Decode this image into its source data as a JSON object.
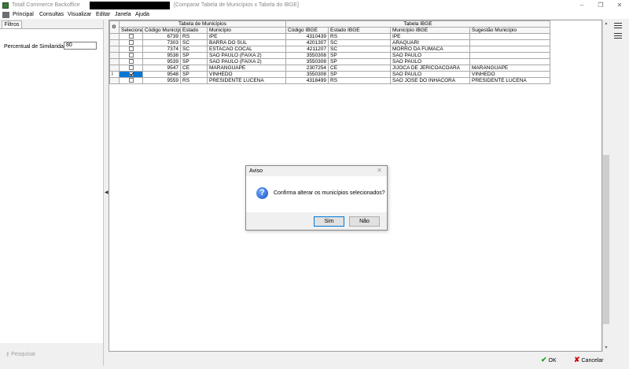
{
  "window": {
    "app_title": "Totall Commerce Backoffice",
    "doc_title": "[Comparar Tabela de Municípios x Tabela do IBGE]",
    "min_glyph": "–",
    "restore_glyph": "❐",
    "close_glyph": "✕"
  },
  "menu": [
    "Principal",
    "Consultas",
    "Visualizar",
    "Editar",
    "Janela",
    "Ajuda"
  ],
  "filters": {
    "tab_label": "Filtros",
    "similarity_label": "Percentual de Similaridade:",
    "similarity_value": "80",
    "search_button": "Pesquisar"
  },
  "grid": {
    "group_municipios": "Tabela de Municípios",
    "group_ibge": "Tabela IBGE",
    "columns": [
      "Selecionar",
      "Código Município",
      "Estado",
      "Município",
      "Código IBGE",
      "Estado IBGE",
      "Município IBGE",
      "Sugestão Município"
    ],
    "rows": [
      {
        "checked": false,
        "codigo": "6739",
        "estado": "RS",
        "municipio": "IPE",
        "codigo_ibge": "4310439",
        "estado_ibge": "RS",
        "municipio_ibge": "IPE",
        "sugestao": ""
      },
      {
        "checked": false,
        "codigo": "7303",
        "estado": "SC",
        "municipio": "BARRA DO SUL",
        "codigo_ibge": "4201307",
        "estado_ibge": "SC",
        "municipio_ibge": "ARAQUARI",
        "sugestao": ""
      },
      {
        "checked": false,
        "codigo": "7374",
        "estado": "SC",
        "municipio": "ESTACAO COCAL",
        "codigo_ibge": "4211207",
        "estado_ibge": "SC",
        "municipio_ibge": "MORRO DA FUMACA",
        "sugestao": ""
      },
      {
        "checked": false,
        "codigo": "9538",
        "estado": "SP",
        "municipio": "SAO PAULO (FAIXA 2)",
        "codigo_ibge": "3550308",
        "estado_ibge": "SP",
        "municipio_ibge": "SAO PAULO",
        "sugestao": ""
      },
      {
        "checked": false,
        "codigo": "9539",
        "estado": "SP",
        "municipio": "SAO PAULO (FAIXA 2)",
        "codigo_ibge": "3550308",
        "estado_ibge": "SP",
        "municipio_ibge": "SAO PAULO",
        "sugestao": ""
      },
      {
        "checked": false,
        "codigo": "9547",
        "estado": "CE",
        "municipio": "MARANGUAPE",
        "codigo_ibge": "2307254",
        "estado_ibge": "CE",
        "municipio_ibge": "JIJOCA DE JERICOACOARA",
        "sugestao": "MARANGUAPE"
      },
      {
        "checked": true,
        "codigo": "9548",
        "estado": "SP",
        "municipio": "VINHEDO",
        "codigo_ibge": "3550308",
        "estado_ibge": "SP",
        "municipio_ibge": "SAO PAULO",
        "sugestao": "VINHEDO"
      },
      {
        "checked": false,
        "codigo": "9559",
        "estado": "RS",
        "municipio": "PRESIDENTE LUCENA",
        "codigo_ibge": "4318499",
        "estado_ibge": "RS",
        "municipio_ibge": "SAO JOSE DO INHACORA",
        "sugestao": "PRESIDENTE LUCENA"
      }
    ]
  },
  "bottom": {
    "ok_label": "OK",
    "cancel_label": "Cancelar"
  },
  "dialog": {
    "title": "Aviso",
    "message": "Confirma alterar os municípios selecionados?",
    "yes_label": "Sim",
    "no_label": "Não",
    "close_glyph": "✕"
  },
  "colors": {
    "selection": "#0078d7",
    "ok": "#1e9e1e",
    "cancel": "#d10000"
  }
}
